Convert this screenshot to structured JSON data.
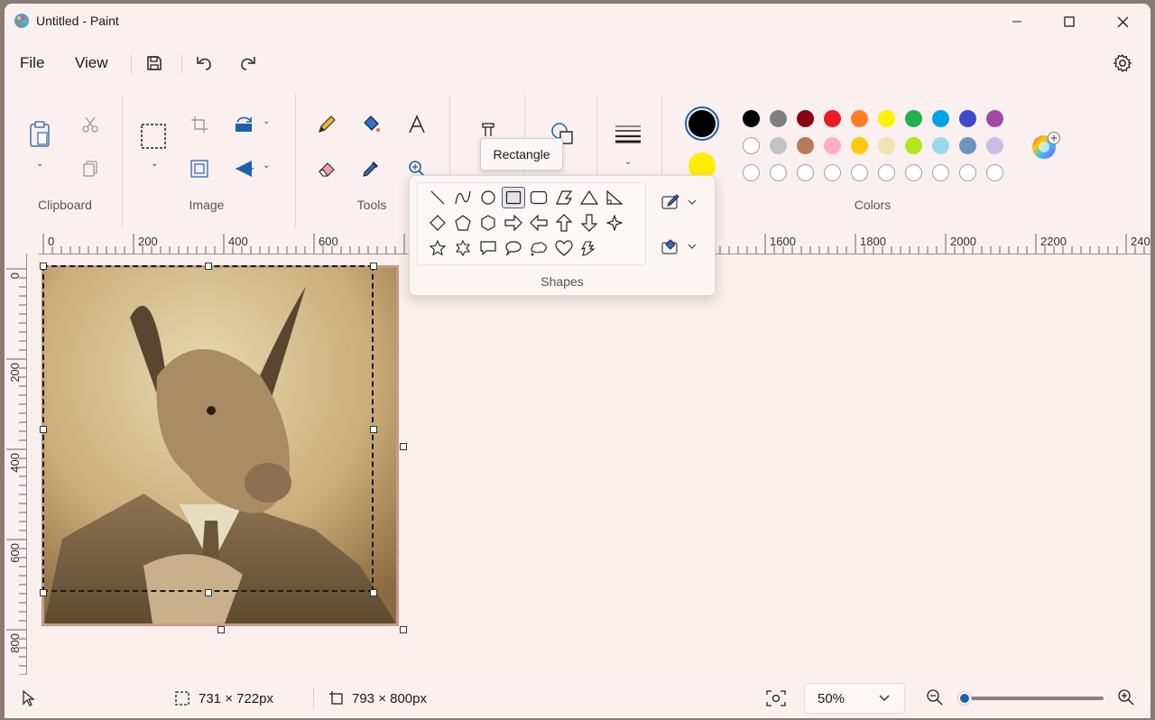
{
  "window": {
    "title": "Untitled - Paint"
  },
  "menu": {
    "file": "File",
    "view": "View"
  },
  "ribbon": {
    "groups": {
      "clipboard": "Clipboard",
      "image": "Image",
      "tools": "Tools",
      "shapes": "Shapes",
      "colors": "Colors"
    },
    "primary_color": "#000000",
    "secondary_color": "#ffee00",
    "palette_row1": [
      "#000000",
      "#7f7f7f",
      "#880015",
      "#ed1c24",
      "#ff7f27",
      "#fff200",
      "#22b14c",
      "#00a2e8",
      "#3f48cc",
      "#a349a4"
    ],
    "palette_row2": [
      "#ffffff",
      "#c3c3c3",
      "#b97a57",
      "#ffaec9",
      "#ffc90e",
      "#efe4b0",
      "#b5e61d",
      "#99d9ea",
      "#7092be",
      "#c8bfe7"
    ]
  },
  "tooltip": {
    "text": "Rectangle"
  },
  "ruler": {
    "h_labels": [
      "0",
      "200",
      "400",
      "600",
      "8",
      "1600",
      "1800",
      "2000",
      "2200",
      "240"
    ],
    "v_labels": [
      "0",
      "200",
      "400",
      "600",
      "800"
    ]
  },
  "status": {
    "selection_size": "731 × 722px",
    "canvas_size": "793 × 800px",
    "zoom": "50%",
    "zoom_slider_fraction": 0.0
  },
  "icons": [
    "paint-app-icon",
    "minimize-icon",
    "maximize-icon",
    "close-icon",
    "save-icon",
    "undo-icon",
    "redo-icon",
    "settings-gear-icon",
    "paste-icon",
    "cut-icon",
    "copy-icon",
    "select-icon",
    "crop-icon",
    "resize-icon",
    "rotate-icon",
    "flip-icon",
    "pencil-icon",
    "fill-icon",
    "text-icon",
    "eraser-icon",
    "color-picker-icon",
    "magnifier-icon",
    "brush-icon",
    "shapes-icon",
    "size-icon",
    "edit-colors-icon",
    "outline-icon",
    "shape-fill-icon",
    "pointer-icon",
    "selection-icon",
    "canvas-size-icon",
    "fit-to-window-icon",
    "zoom-out-icon",
    "zoom-in-icon"
  ]
}
